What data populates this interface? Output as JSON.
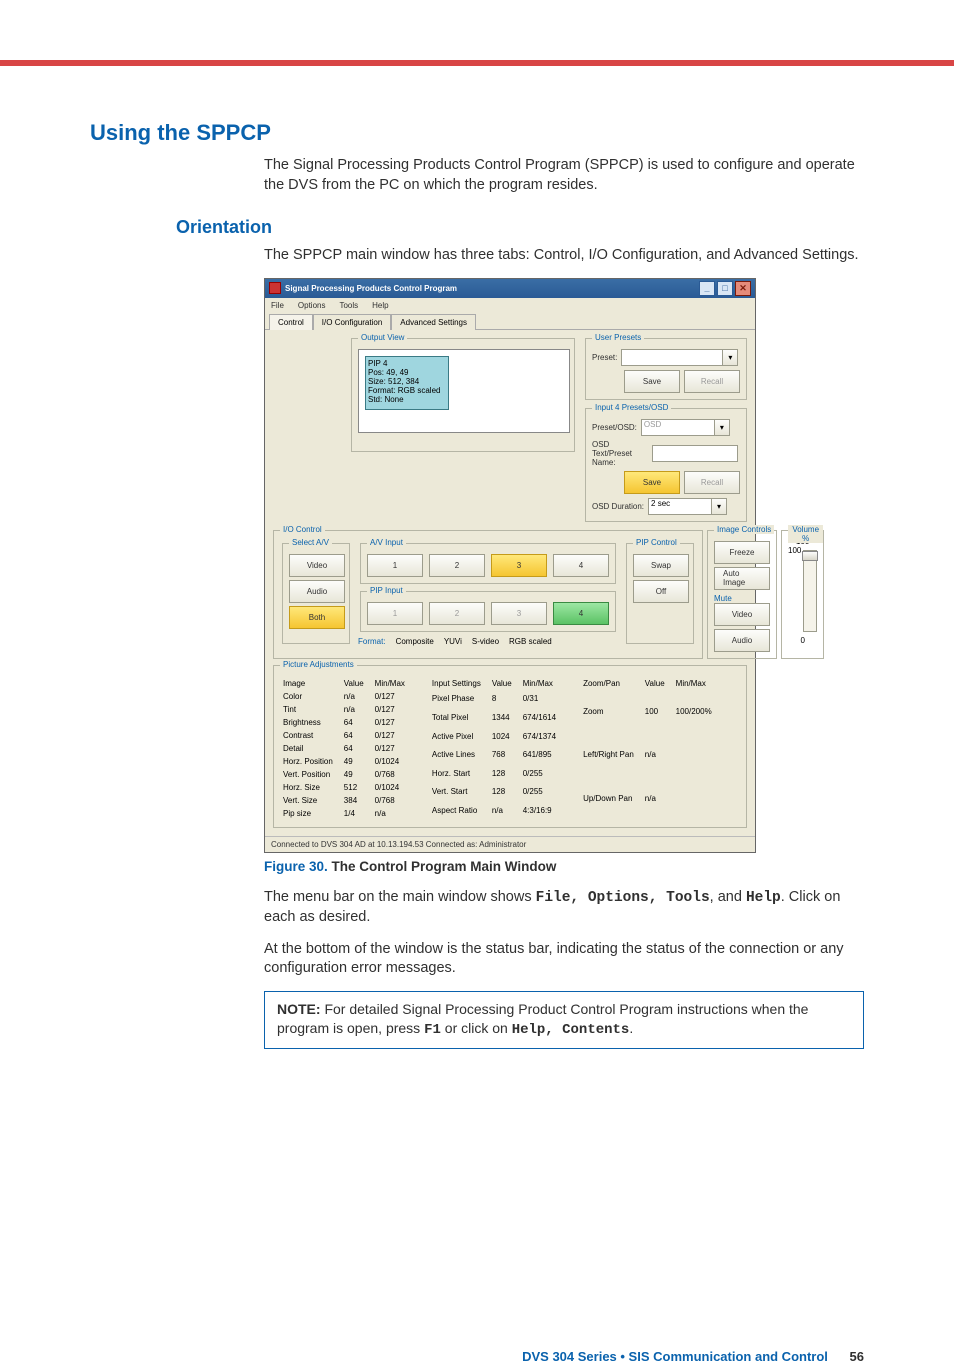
{
  "page": {
    "h1": "Using the SPPCP",
    "intro": "The Signal Processing Products Control Program (SPPCP) is used to configure and operate the DVS from the PC on which the program resides.",
    "h2": "Orientation",
    "orientationText": "The SPPCP main window has three tabs: Control, I/O Configuration, and Advanced Settings.",
    "figCaptionLabel": "Figure 30.",
    "figCaptionText": "The Control Program Main Window",
    "para1a": "The menu bar on the main window shows ",
    "para1b": ", and ",
    "para1c": ". Click on each as desired.",
    "menuCodes": "File, Options, Tools",
    "helpCode": "Help",
    "para2": "At the bottom of the window is the status bar, indicating the status of the connection or any configuration error messages.",
    "noteLabel": "NOTE:",
    "noteText1": "For detailed Signal Processing Product Control Program instructions when the program is open, press ",
    "noteKey": "F1",
    "noteText2": " or click on ",
    "noteHelpCode": "Help, Contents",
    "noteText3": "."
  },
  "footer": {
    "title": "DVS 304 Series • SIS Communication and Control",
    "page": "56"
  },
  "app": {
    "title": "Signal Processing Products Control Program",
    "menus": [
      "File",
      "Options",
      "Tools",
      "Help"
    ],
    "tabs": [
      "Control",
      "I/O Configuration",
      "Advanced Settings"
    ],
    "activeTab": "Control",
    "outputView": {
      "label": "Output View",
      "pip": [
        "PIP 4",
        "Pos: 49, 49",
        "Size: 512, 384",
        "Format: RGB scaled",
        "Std: None"
      ]
    },
    "userPresets": {
      "legend": "User Presets",
      "presetLabel": "Preset:",
      "save": "Save",
      "recall": "Recall"
    },
    "input4": {
      "legend": "Input 4 Presets/OSD",
      "presetOsdLabel": "Preset/OSD:",
      "presetOsdValue": "OSD",
      "osdNameLabel": "OSD Text/Preset Name:",
      "save": "Save",
      "recall": "Recall",
      "osdDurLabel": "OSD Duration:",
      "osdDurValue": "2 sec"
    },
    "ioControl": {
      "legend": "I/O Control",
      "selectAV": "Select A/V",
      "video": "Video",
      "audio": "Audio",
      "both": "Both",
      "avInput": "A/V Input",
      "pipInput": "PIP Input",
      "inputs": [
        "1",
        "2",
        "3",
        "4"
      ],
      "formatLabel": "Format:",
      "formats": [
        "Composite",
        "YUVi",
        "S-video",
        "RGB scaled"
      ],
      "pipControl": "PIP Control",
      "swap": "Swap",
      "off": "Off"
    },
    "imageControls": {
      "legend": "Image Controls",
      "freeze": "Freeze",
      "autoImage": "Auto Image",
      "mute": "Mute",
      "video": "Video",
      "audio": "Audio"
    },
    "volume": {
      "legend": "Volume %",
      "top": "100",
      "cur": "100",
      "bot": "0"
    },
    "pictureAdj": {
      "legend": "Picture Adjustments",
      "headers": [
        "Image",
        "Value",
        "Min/Max"
      ],
      "rows": [
        [
          "Color",
          "n/a",
          "0/127"
        ],
        [
          "Tint",
          "n/a",
          "0/127"
        ],
        [
          "Brightness",
          "64",
          "0/127"
        ],
        [
          "Contrast",
          "64",
          "0/127"
        ],
        [
          "Detail",
          "64",
          "0/127"
        ],
        [
          "Horz. Position",
          "49",
          "0/1024"
        ],
        [
          "Vert. Position",
          "49",
          "0/768"
        ],
        [
          "Horz. Size",
          "512",
          "0/1024"
        ],
        [
          "Vert. Size",
          "384",
          "0/768"
        ],
        [
          "Pip size",
          "1/4",
          "n/a"
        ]
      ],
      "headers2": [
        "Input Settings",
        "Value",
        "Min/Max"
      ],
      "rows2": [
        [
          "Pixel Phase",
          "8",
          "0/31"
        ],
        [
          "Total Pixel",
          "1344",
          "674/1614"
        ],
        [
          "Active Pixel",
          "1024",
          "674/1374"
        ],
        [
          "Active Lines",
          "768",
          "641/895"
        ],
        [
          "Horz. Start",
          "128",
          "0/255"
        ],
        [
          "Vert. Start",
          "128",
          "0/255"
        ],
        [
          "Aspect Ratio",
          "n/a",
          "4:3/16:9"
        ]
      ],
      "headers3": [
        "Zoom/Pan",
        "Value",
        "Min/Max"
      ],
      "rows3": [
        [
          "Zoom",
          "100",
          "100/200%"
        ],
        [
          "Left/Right Pan",
          "n/a",
          ""
        ],
        [
          "Up/Down Pan",
          "n/a",
          ""
        ]
      ]
    },
    "status": "Connected to DVS 304 AD at 10.13.194.53   Connected as: Administrator"
  }
}
